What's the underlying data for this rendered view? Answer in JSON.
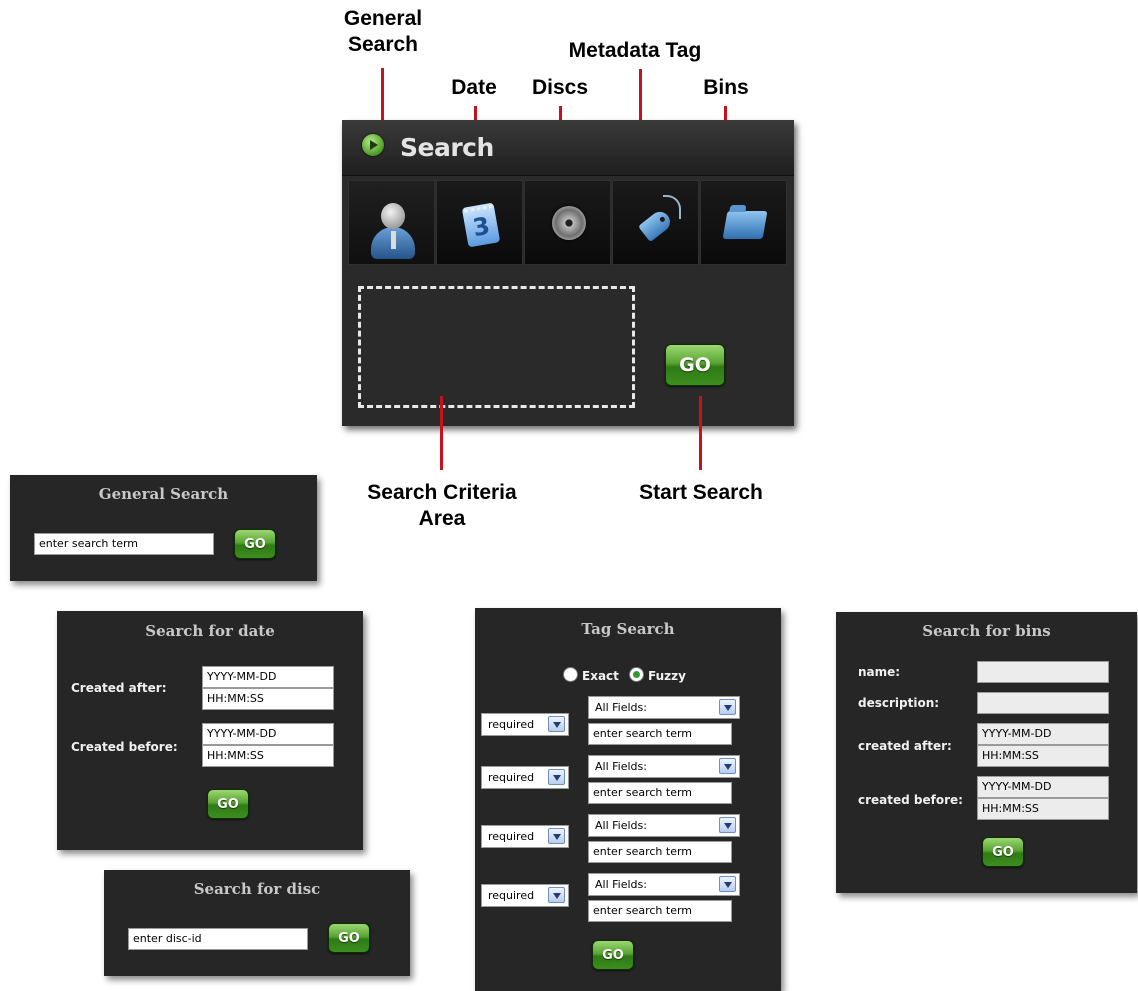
{
  "annotations": {
    "general_search": "General\nSearch",
    "general_search_line1": "General",
    "general_search_line2": "Search",
    "date": "Date",
    "discs": "Discs",
    "metadata_tag": "Metadata Tag",
    "bins": "Bins",
    "search_criteria_line1": "Search Criteria",
    "search_criteria_line2": "Area",
    "start_search": "Start Search"
  },
  "main_panel": {
    "title": "Search",
    "go_label": "GO",
    "tabs": [
      {
        "name": "general-search",
        "icon": "person-icon"
      },
      {
        "name": "date",
        "icon": "calendar-icon",
        "glyph": "3"
      },
      {
        "name": "discs",
        "icon": "disc-icon"
      },
      {
        "name": "metadata-tag",
        "icon": "tag-icon"
      },
      {
        "name": "bins",
        "icon": "folder-icon"
      }
    ]
  },
  "general_search_panel": {
    "title": "General Search",
    "input_value": "enter search term",
    "go_label": "GO"
  },
  "date_panel": {
    "title": "Search for date",
    "created_after_label": "Created after:",
    "created_before_label": "Created before:",
    "after_date": "YYYY-MM-DD",
    "after_time": "HH:MM:SS",
    "before_date": "YYYY-MM-DD",
    "before_time": "HH:MM:SS",
    "go_label": "GO"
  },
  "disc_panel": {
    "title": "Search for disc",
    "input_value": "enter disc-id",
    "go_label": "GO"
  },
  "tag_panel": {
    "title": "Tag Search",
    "exact_label": "Exact",
    "fuzzy_label": "Fuzzy",
    "selected_mode": "Fuzzy",
    "rows": [
      {
        "qualifier": "required",
        "field": "All Fields:",
        "term": "enter search term"
      },
      {
        "qualifier": "required",
        "field": "All Fields:",
        "term": "enter search term"
      },
      {
        "qualifier": "required",
        "field": "All Fields:",
        "term": "enter search term"
      },
      {
        "qualifier": "required",
        "field": "All Fields:",
        "term": "enter search term"
      }
    ],
    "go_label": "GO"
  },
  "bins_panel": {
    "title": "Search for bins",
    "name_label": "name:",
    "description_label": "description:",
    "created_after_label": "created after:",
    "created_before_label": "created before:",
    "name_value": "",
    "description_value": "",
    "after_date": "YYYY-MM-DD",
    "after_time": "HH:MM:SS",
    "before_date": "YYYY-MM-DD",
    "before_time": "HH:MM:SS",
    "go_label": "GO"
  },
  "colors": {
    "annotation_line": "#c8101e",
    "panel_bg": "#262626",
    "go_green": "#3c8e1e"
  }
}
